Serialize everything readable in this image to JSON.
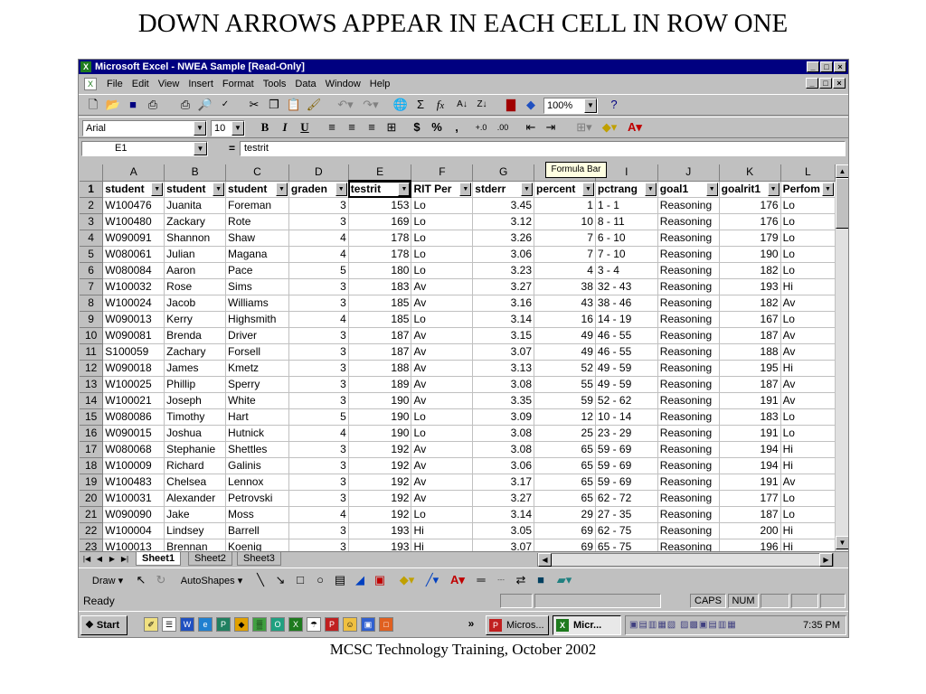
{
  "slide": {
    "title": "DOWN ARROWS APPEAR IN EACH CELL IN ROW ONE",
    "caption": "MCSC Technology Training, October 2002"
  },
  "window": {
    "title": "Microsoft Excel - NWEA Sample  [Read-Only]",
    "caption_buttons": [
      "_",
      "□",
      "×"
    ]
  },
  "menu": [
    "File",
    "Edit",
    "View",
    "Insert",
    "Format",
    "Tools",
    "Data",
    "Window",
    "Help"
  ],
  "standard_toolbar": {
    "zoom": "100%",
    "icons": [
      "new-icon",
      "open-icon",
      "save-icon",
      "permission-icon",
      "print-icon",
      "print-preview-icon",
      "spelling-icon",
      "cut-icon",
      "copy-icon",
      "paste-icon",
      "format-painter-icon",
      "undo-icon",
      "redo-icon",
      "hyperlink-icon",
      "autosum-icon",
      "function-icon",
      "sort-ascending-icon",
      "sort-descending-icon",
      "chart-wizard-icon",
      "drawing-icon",
      "help-icon"
    ]
  },
  "formatting_toolbar": {
    "font": "Arial",
    "size": "10",
    "bold": "B",
    "italic": "I",
    "underline": "U",
    "currency": "$",
    "percent": "%",
    "comma": ","
  },
  "formula_bar": {
    "name_box": "E1",
    "equals": "=",
    "content": "testrit",
    "tooltip": "Formula Bar"
  },
  "sheet": {
    "columns": [
      "A",
      "B",
      "C",
      "D",
      "E",
      "F",
      "G",
      "H",
      "I",
      "J",
      "K",
      "L"
    ],
    "headers": [
      "student",
      "student",
      "student",
      "graden",
      "testrit",
      "RIT Per",
      "stderr",
      "percent",
      "pctrang",
      "goal1",
      "goalrit1",
      "Perfom"
    ],
    "rows": [
      [
        "W100476",
        "Juanita",
        "Foreman",
        "3",
        "153",
        "Lo",
        "3.45",
        "1",
        "1 - 1",
        "Reasoning",
        "176",
        "Lo"
      ],
      [
        "W100480",
        "Zackary",
        "Rote",
        "3",
        "169",
        "Lo",
        "3.12",
        "10",
        "8 - 11",
        "Reasoning",
        "176",
        "Lo"
      ],
      [
        "W090091",
        "Shannon",
        "Shaw",
        "4",
        "178",
        "Lo",
        "3.26",
        "7",
        "6 - 10",
        "Reasoning",
        "179",
        "Lo"
      ],
      [
        "W080061",
        "Julian",
        "Magana",
        "4",
        "178",
        "Lo",
        "3.06",
        "7",
        "7 - 10",
        "Reasoning",
        "190",
        "Lo"
      ],
      [
        "W080084",
        "Aaron",
        "Pace",
        "5",
        "180",
        "Lo",
        "3.23",
        "4",
        "3 - 4",
        "Reasoning",
        "182",
        "Lo"
      ],
      [
        "W100032",
        "Rose",
        "Sims",
        "3",
        "183",
        "Av",
        "3.27",
        "38",
        "32 - 43",
        "Reasoning",
        "193",
        "Hi"
      ],
      [
        "W100024",
        "Jacob",
        "Williams",
        "3",
        "185",
        "Av",
        "3.16",
        "43",
        "38 - 46",
        "Reasoning",
        "182",
        "Av"
      ],
      [
        "W090013",
        "Kerry",
        "Highsmith",
        "4",
        "185",
        "Lo",
        "3.14",
        "16",
        "14 - 19",
        "Reasoning",
        "167",
        "Lo"
      ],
      [
        "W090081",
        "Brenda",
        "Driver",
        "3",
        "187",
        "Av",
        "3.15",
        "49",
        "46 - 55",
        "Reasoning",
        "187",
        "Av"
      ],
      [
        "S100059",
        "Zachary",
        "Forsell",
        "3",
        "187",
        "Av",
        "3.07",
        "49",
        "46 - 55",
        "Reasoning",
        "188",
        "Av"
      ],
      [
        "W090018",
        "James",
        "Kmetz",
        "3",
        "188",
        "Av",
        "3.13",
        "52",
        "49 - 59",
        "Reasoning",
        "195",
        "Hi"
      ],
      [
        "W100025",
        "Phillip",
        "Sperry",
        "3",
        "189",
        "Av",
        "3.08",
        "55",
        "49 - 59",
        "Reasoning",
        "187",
        "Av"
      ],
      [
        "W100021",
        "Joseph",
        "White",
        "3",
        "190",
        "Av",
        "3.35",
        "59",
        "52 - 62",
        "Reasoning",
        "191",
        "Av"
      ],
      [
        "W080086",
        "Timothy",
        "Hart",
        "5",
        "190",
        "Lo",
        "3.09",
        "12",
        "10 - 14",
        "Reasoning",
        "183",
        "Lo"
      ],
      [
        "W090015",
        "Joshua",
        "Hutnick",
        "4",
        "190",
        "Lo",
        "3.08",
        "25",
        "23 - 29",
        "Reasoning",
        "191",
        "Lo"
      ],
      [
        "W080068",
        "Stephanie",
        "Shettles",
        "3",
        "192",
        "Av",
        "3.08",
        "65",
        "59 - 69",
        "Reasoning",
        "194",
        "Hi"
      ],
      [
        "W100009",
        "Richard",
        "Galinis",
        "3",
        "192",
        "Av",
        "3.06",
        "65",
        "59 - 69",
        "Reasoning",
        "194",
        "Hi"
      ],
      [
        "W100483",
        "Chelsea",
        "Lennox",
        "3",
        "192",
        "Av",
        "3.17",
        "65",
        "59 - 69",
        "Reasoning",
        "191",
        "Av"
      ],
      [
        "W100031",
        "Alexander",
        "Petrovski",
        "3",
        "192",
        "Av",
        "3.27",
        "65",
        "62 - 72",
        "Reasoning",
        "177",
        "Lo"
      ],
      [
        "W090090",
        "Jake",
        "Moss",
        "4",
        "192",
        "Lo",
        "3.14",
        "29",
        "27 - 35",
        "Reasoning",
        "187",
        "Lo"
      ],
      [
        "W100004",
        "Lindsey",
        "Barrell",
        "3",
        "193",
        "Hi",
        "3.05",
        "69",
        "62 - 75",
        "Reasoning",
        "200",
        "Hi"
      ],
      [
        "W100013",
        "Brennan",
        "Koenig",
        "3",
        "193",
        "Hi",
        "3.07",
        "69",
        "65 - 75",
        "Reasoning",
        "196",
        "Hi"
      ]
    ],
    "tabs": [
      "Sheet1",
      "Sheet2",
      "Sheet3"
    ]
  },
  "drawing_toolbar": {
    "draw": "Draw",
    "autoshapes": "AutoShapes"
  },
  "status": {
    "ready": "Ready",
    "caps": "CAPS",
    "num": "NUM"
  },
  "taskbar": {
    "start": "Start",
    "overflow": "»",
    "buttons": [
      "Micros...",
      "Micr..."
    ],
    "clock": "7:35 PM"
  }
}
